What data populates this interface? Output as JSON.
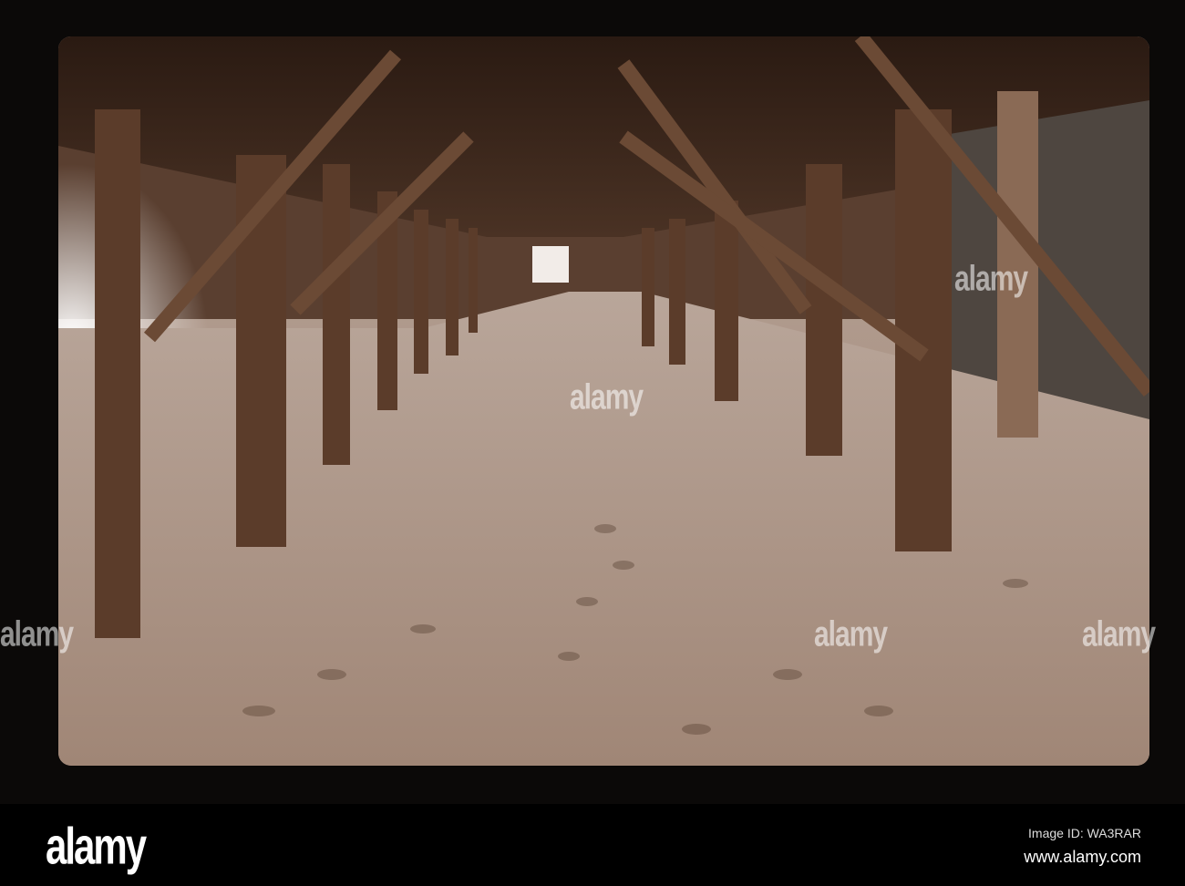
{
  "photo": {
    "subject": "Under a wooden pier on sand",
    "watermark_text": "alamy"
  },
  "footer": {
    "logo": "alamy",
    "image_id": "Image ID: WA3RAR",
    "website": "www.alamy.com"
  }
}
